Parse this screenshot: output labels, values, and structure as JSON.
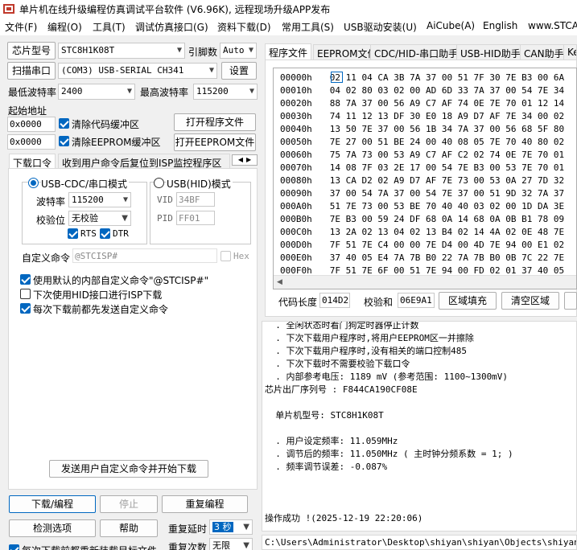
{
  "app": {
    "title": "单片机在线升级编程仿真调试平台软件 (V6.96K), 远程现场升级APP发布"
  },
  "menu": [
    "文件(F)",
    "编程(O)",
    "工具(T)",
    "调试仿真接口(G)",
    "资料下载(D)",
    "常用工具(S)",
    "USB驱动安装(U)",
    "AiCube(A)",
    "English",
    "www.STCA"
  ],
  "left": {
    "chip_model_btn": "芯片型号",
    "chip_model_value": "STC8H1K08T",
    "pin_label": "引脚数",
    "pin_value": "Auto",
    "scan_port_btn": "扫描串口",
    "port_value": "(COM3) USB-SERIAL CH341",
    "settings_btn": "设置",
    "min_baud_label": "最低波特率",
    "min_baud_value": "2400",
    "max_baud_label": "最高波特率",
    "max_baud_value": "115200",
    "start_addr_label": "起始地址",
    "code_addr": "0x0000",
    "clear_code_label": "清除代码缓冲区",
    "open_prog_btn": "打开程序文件",
    "eeprom_addr": "0x0000",
    "clear_eeprom_label": "清除EEPROM缓冲区",
    "open_eeprom_btn": "打开EEPROM文件",
    "tabs": [
      "下载口令",
      "收到用户命令后复位到ISP监控程序区"
    ],
    "usb_cdc_label": "USB-CDC/串口模式",
    "usb_hid_label": "USB(HID)模式",
    "baud_label": "波特率",
    "baud_value": "115200",
    "parity_label": "校验位",
    "parity_value": "无校验",
    "rts_label": "RTS",
    "dtr_label": "DTR",
    "vid_label": "VID",
    "vid_value": "34BF",
    "pid_label": "PID",
    "pid_value": "FF01",
    "custom_cmd_label": "自定义命令",
    "custom_cmd_value": "@STCISP#",
    "hex_label": "Hex",
    "opt1": "使用默认的内部自定义命令\"@STCISP#\"",
    "opt2": "下次使用HID接口进行ISP下载",
    "opt3": "每次下载前都先发送自定义命令",
    "send_btn": "发送用户自定义命令并开始下载",
    "download_btn": "下载/编程",
    "stop_btn": "停止",
    "reprogram_btn": "重复编程",
    "check_btn": "检测选项",
    "help_btn": "帮助",
    "delay_label": "重复延时",
    "delay_value": "3 秒",
    "count_label": "重复次数",
    "count_value": "无限",
    "bottom_opt": "每次下载前都重新装载目标文件"
  },
  "right": {
    "tabs": [
      "程序文件",
      "EEPROM文件",
      "CDC/HID-串口助手",
      "USB-HID助手",
      "CAN助手",
      "Ke"
    ],
    "hex_rows": [
      {
        "addr": "00000h",
        "bytes": "02 11 04 CA 3B 7A 37 00 51 7F 30 7E B3 00 6A"
      },
      {
        "addr": "00010h",
        "bytes": "04 02 80 03 02 00 AD 6D 33 7A 37 00 54 7E 34"
      },
      {
        "addr": "00020h",
        "bytes": "88 7A 37 00 56 A9 C7 AF 74 0E 7E 70 01 12 14"
      },
      {
        "addr": "00030h",
        "bytes": "74 11 12 13 DF 30 E0 18 A9 D7 AF 7E 34 00 02"
      },
      {
        "addr": "00040h",
        "bytes": "13 50 7E 37 00 56 1B 34 7A 37 00 56 68 5F 80"
      },
      {
        "addr": "00050h",
        "bytes": "7E 27 00 51 BE 24 00 40 08 05 7E 70 40 80 02"
      },
      {
        "addr": "00060h",
        "bytes": "75 7A 73 00 53 A9 C7 AF C2 02 74 0E 7E 70 01"
      },
      {
        "addr": "00070h",
        "bytes": "14 08 7F 03 2E 17 00 54 7E B3 00 53 7E 70 01"
      },
      {
        "addr": "00080h",
        "bytes": "13 CA D2 02 A9 D7 AF 7E 73 00 53 0A 27 7D 32"
      },
      {
        "addr": "00090h",
        "bytes": "37 00 54 7A 37 00 54 7E 37 00 51 9D 32 7A 37"
      },
      {
        "addr": "000A0h",
        "bytes": "51 7E 73 00 53 BE 70 40 40 03 02 00 1D DA 3E"
      },
      {
        "addr": "000B0h",
        "bytes": "7E B3 00 59 24 DF 68 0A 14 68 0A 0B B1 78 09"
      },
      {
        "addr": "000C0h",
        "bytes": "13 2A 02 13 04 02 13 B4 02 14 4A 02 0E 48 7E"
      },
      {
        "addr": "000D0h",
        "bytes": "7F 51 7E C4 00 00 7E D4 00 4D 7E 94 00 E1 02"
      },
      {
        "addr": "000E0h",
        "bytes": "37 40 05 E4 7A 7B B0 22 7A 7B B0 0B 7C 22 7E"
      },
      {
        "addr": "000F0h",
        "bytes": "7F 51 7E 6F 00 51 7E 94 00 FD 02 01 37 40 05"
      }
    ],
    "code_len_label": "代码长度",
    "code_len_value": "014D2",
    "checksum_label": "校验和",
    "checksum_value": "06E9A1",
    "fill_btn": "区域填充",
    "clear_btn": "清空区域",
    "log_lines": [
      "  . 全闲状态时看门狗定时器停止计数",
      "  . 下次下载用户程序时,将用户EEPROM区一并擦除",
      "  . 下次下载用户程序时,没有相关的端口控制485",
      "  . 下次下载时不需要校验下载口令",
      "  . 内部参考电压: 1189 mV (参考范围: 1100~1300mV)",
      "芯片出厂序列号 : F844CA190CF08E",
      "",
      "  单片机型号: STC8H1K08T",
      "",
      "  . 用户设定频率: 11.059MHz",
      "  . 调节后的频率: 11.050MHz ( 主时钟分频系数 = 1; )",
      "  . 频率调节误差: -0.087%",
      "",
      "",
      "",
      "操作成功 !(2025-12-19 22:20:06)"
    ],
    "file_path": "C:\\Users\\Administrator\\Desktop\\shiyan\\shiyan\\Objects\\shiyan.hex"
  }
}
